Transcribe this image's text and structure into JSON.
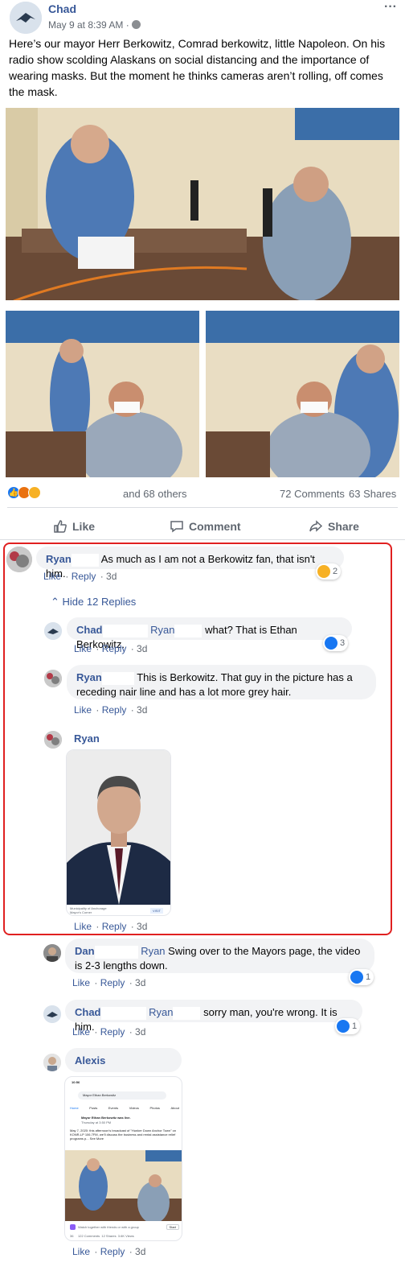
{
  "post": {
    "author": "Chad",
    "timestamp": "May 9 at 8:39 AM",
    "privacy_sep": "·",
    "text": "Here’s our mayor Herr Berkowitz, Comrad berkowitz, little Napoleon. On his radio show scolding Alaskans on social distancing and the importance of wearing masks. But the moment he thinks cameras aren’t rolling, off comes the mask.",
    "more": "···",
    "reactions_text": "and 68 others",
    "comments_count": "72 Comments",
    "shares_count": "63 Shares",
    "actions": {
      "like": "Like",
      "comment": "Comment",
      "share": "Share"
    }
  },
  "comments": [
    {
      "author": "Ryan",
      "text": "As much as I am not a Berkowitz fan, that isn't him.",
      "reaction_count": "2",
      "like": "Like",
      "reply": "Reply",
      "age": "3d",
      "hide_replies": "Hide 12 Replies"
    },
    {
      "author": "Chad",
      "mention": "Ryan",
      "text": "what? That is Ethan Berkowitz.",
      "reaction_count": "3",
      "like": "Like",
      "reply": "Reply",
      "age": "3d"
    },
    {
      "author": "Ryan",
      "text": "This is Berkowitz. That guy in the picture has a receding nair line and has a lot more grey hair.",
      "like": "Like",
      "reply": "Reply",
      "age": "3d"
    },
    {
      "author": "Ryan",
      "caption1": "Municipality of Anchorage",
      "caption2": "Mayor's Corner",
      "visit": "VISIT",
      "like": "Like",
      "reply": "Reply",
      "age": "3d"
    },
    {
      "author": "Dan",
      "mention": "Ryan",
      "text": "Swing over to the Mayors page, the video is 2-3 lengths down.",
      "reaction_count": "1",
      "like": "Like",
      "reply": "Reply",
      "age": "3d"
    },
    {
      "author": "Chad",
      "mention": "Ryan",
      "text": "sorry man, you're wrong. It is him.",
      "reaction_count": "1",
      "like": "Like",
      "reply": "Reply",
      "age": "3d"
    },
    {
      "author": "Alexis",
      "like": "Like",
      "reply": "Reply",
      "age": "3d"
    }
  ],
  "screenshot": {
    "time": "10:56",
    "search": "Mayor Ethan Berkowitz",
    "tabs": [
      "Home",
      "Posts",
      "Events",
      "Videos",
      "Photos",
      "About"
    ],
    "poster": "Mayor Ethan Berkowitz was live.",
    "date": "Thursday at 3:50 PM",
    "body": "May 7, 2020: this afternoon's broadcast of \"Hunker Down Anchor Town\" on KONR-LP 106.7FM, we'll discuss the business and rental assistance relief programs p... See More",
    "watch": "Watch together with friends or with a group",
    "start": "Start",
    "stats": "36     122 Comments  12 Shares  3.6K Views"
  },
  "colors": {
    "brand": "#385898",
    "highlight": "#e02020",
    "bubble": "#f2f3f5"
  }
}
